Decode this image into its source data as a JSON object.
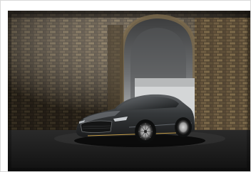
{
  "image": {
    "subject": "car-photo",
    "colors": {
      "brick": "#5a4a35",
      "brick_light": "#8a7654",
      "brick_dark": "#2e2820",
      "arch_inner": "#7a7c7e",
      "car_body": "#2f3234",
      "car_highlight": "#5d6063",
      "floor": "#232323",
      "accent_stripe": "#c8a04a"
    }
  }
}
